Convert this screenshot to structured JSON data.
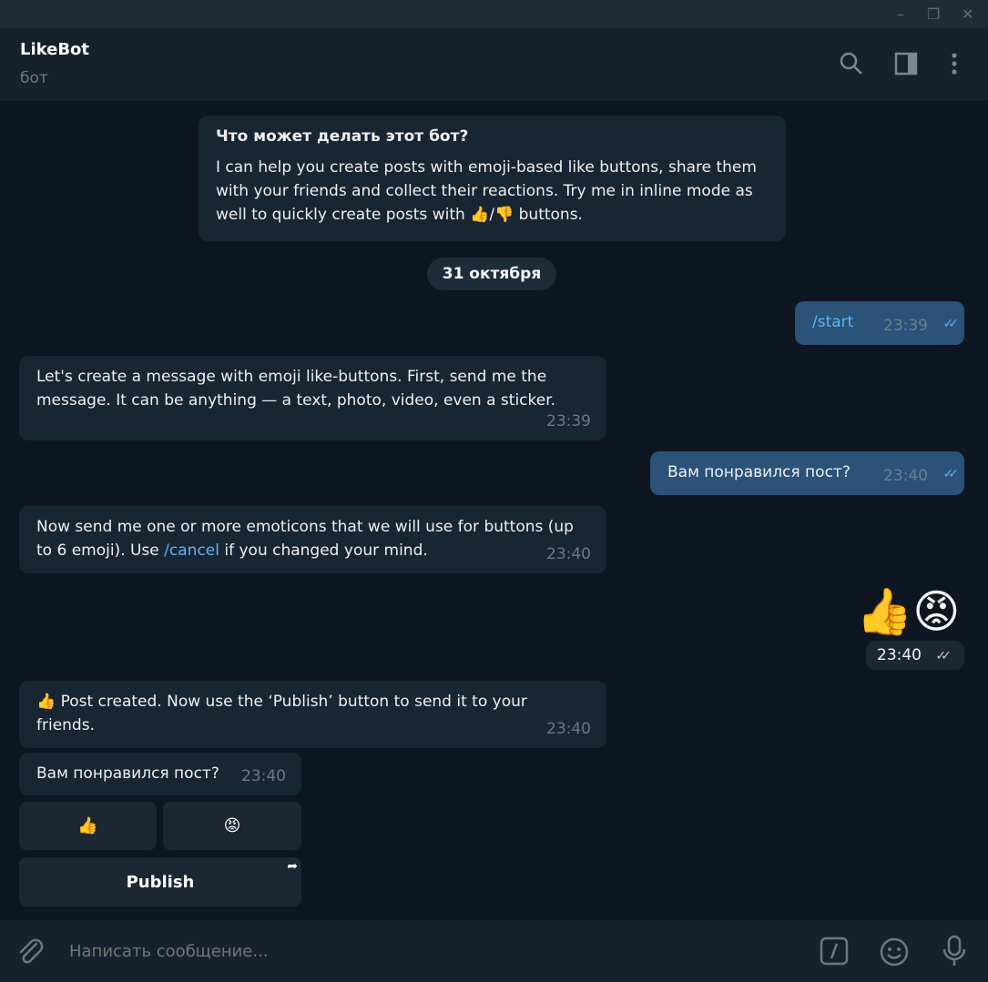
{
  "window": {
    "minimize": "–",
    "restore": "❐",
    "close": "✕"
  },
  "header": {
    "title": "LikeBot",
    "subtitle": "бот",
    "icons": [
      "search-icon",
      "sidebar-toggle-icon",
      "more-vertical-icon"
    ]
  },
  "bot_info": {
    "title": "Что может делать этот бот?",
    "text": "I can help you create posts with emoji-based like buttons, share them with your friends and collect their reactions. Try me in inline mode as well to quickly create posts with 👍/👎 buttons."
  },
  "date_badge": "31 октября",
  "messages": [
    {
      "dir": "out",
      "text": "/start",
      "time": "23:39"
    },
    {
      "dir": "in",
      "text": "Let's create a message with emoji like-buttons. First, send me the message. It can be anything — a text, photo, video, even a sticker.",
      "time": "23:39"
    },
    {
      "dir": "out",
      "text": "Вам понравился пост?",
      "time": "23:40"
    },
    {
      "dir": "in",
      "text_before": "Now send me one or more emoticons that we will use for buttons (up to 6 emoji). Use ",
      "link": "/cancel",
      "text_after": " if you changed your mind.",
      "time": "23:40"
    },
    {
      "dir": "out",
      "text": "👍😡",
      "time": "23:40"
    },
    {
      "dir": "in",
      "text": "👍 Post created. Now use the ‘Publish’ button to send it to your friends.",
      "time": "23:40"
    },
    {
      "dir": "in",
      "text": "Вам понравился пост?",
      "time": "23:40"
    }
  ],
  "keyboard": {
    "buttons": [
      "👍",
      "😡"
    ],
    "publish": "Publish"
  },
  "composer": {
    "placeholder": "Написать сообщение...",
    "icons": [
      "attach-icon",
      "bot-command-icon",
      "emoji-icon",
      "microphone-icon"
    ]
  },
  "colors": {
    "background": "#0e1621",
    "incoming": "#182533",
    "outgoing": "#2b5278",
    "link": "#5eb5f7"
  }
}
